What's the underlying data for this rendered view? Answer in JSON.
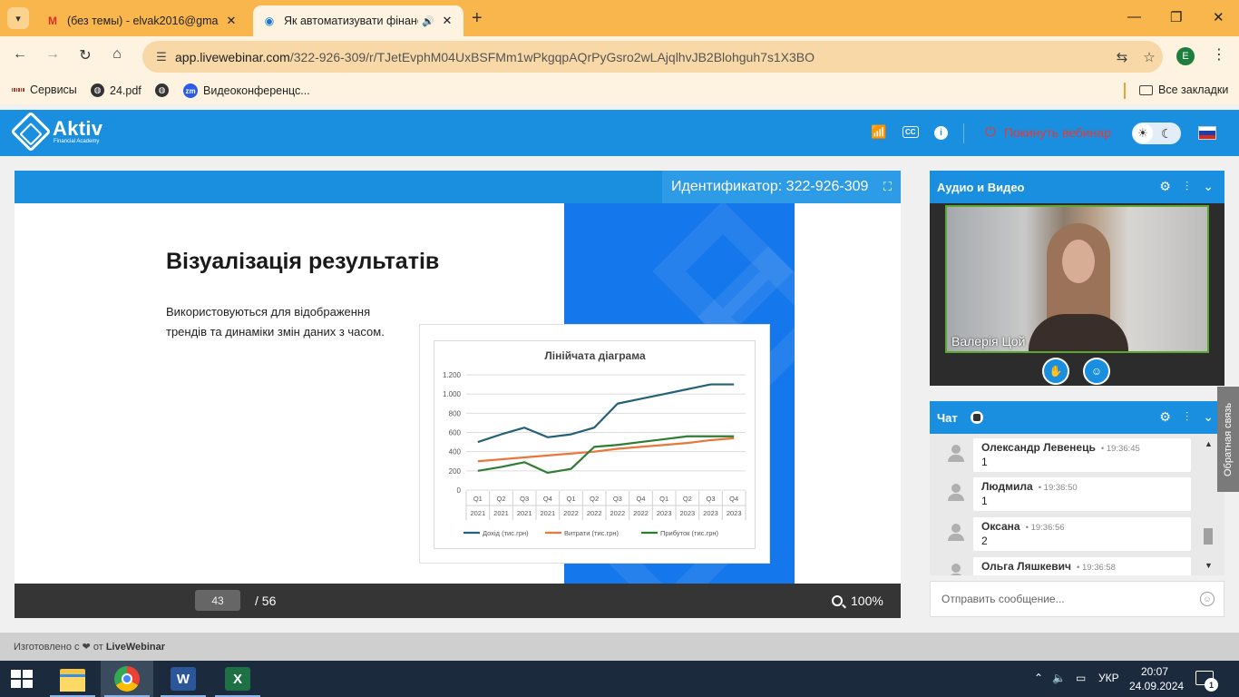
{
  "browser": {
    "tabs": [
      {
        "title": "(без темы) - elvak2016@gmail.",
        "favicon": "gmail-icon",
        "active": false
      },
      {
        "title": "Як автоматизувати фінансо",
        "favicon": "livewebinar-icon",
        "active": true
      }
    ],
    "url_host": "app.livewebinar.com",
    "url_path": "/322-926-309/r/TJetEvphM04UxBSFMm1wPkgqpAQrPyGsro2wLAjqlhvJB2Blohguh7s1X3BO",
    "profile_initial": "E",
    "bookmarks": [
      {
        "label": "Сервисы",
        "icon": "apps-grid-icon"
      },
      {
        "label": "24.pdf",
        "icon": "globe-icon"
      },
      {
        "label": "",
        "icon": "globe-icon"
      },
      {
        "label": "Видеоконференцс...",
        "icon": "zoom-icon"
      }
    ],
    "all_bookmarks": "Все закладки"
  },
  "app": {
    "logo_name": "Aktiv",
    "logo_sub": "Financial Academy",
    "leave_label": "Покинуть вебинар",
    "accent": "#1a8fe0",
    "leave_color": "#e53935"
  },
  "presentation": {
    "identifier": "Идентификатор: 322-926-309",
    "slide_title": "Візуалізація результатів",
    "slide_text": "Використовуються для відображення трендів та динаміки змін даних з часом.",
    "page_current": "43",
    "page_total": "/ 56",
    "zoom": "100%"
  },
  "chart_data": {
    "type": "line",
    "title": "Лінійчата діаграма",
    "categories": [
      "Q1",
      "Q2",
      "Q3",
      "Q4",
      "Q1",
      "Q2",
      "Q3",
      "Q4",
      "Q1",
      "Q2",
      "Q3",
      "Q4"
    ],
    "years": [
      "2021",
      "2021",
      "2021",
      "2021",
      "2022",
      "2022",
      "2022",
      "2022",
      "2023",
      "2023",
      "2023",
      "2023"
    ],
    "ylim": [
      0,
      1200
    ],
    "yticks": [
      "0",
      "200",
      "400",
      "600",
      "800",
      "1.000",
      "1.200"
    ],
    "grid": true,
    "legend_position": "bottom",
    "series": [
      {
        "name": "Дохід (тис.грн)",
        "color": "#24607a",
        "values": [
          500,
          580,
          650,
          550,
          580,
          650,
          900,
          950,
          1000,
          1050,
          1100,
          1100
        ]
      },
      {
        "name": "Витрати (тис.грн)",
        "color": "#e8773a",
        "values": [
          300,
          320,
          340,
          360,
          380,
          400,
          430,
          450,
          470,
          490,
          520,
          540
        ]
      },
      {
        "name": "Прибуток (тис.грн)",
        "color": "#2e7d32",
        "values": [
          200,
          240,
          290,
          180,
          220,
          450,
          470,
          500,
          530,
          560,
          560,
          560
        ]
      }
    ]
  },
  "footer": {
    "made_prefix": "Изготовлено с ❤ от",
    "made_brand": "LiveWebinar"
  },
  "av_panel": {
    "title": "Аудио и Видео",
    "speaker_name": "Валерія Цой"
  },
  "chat": {
    "title": "Чат",
    "messages": [
      {
        "name": "Олександр Левенець",
        "time": "19:36:45",
        "text": "1"
      },
      {
        "name": "Людмила",
        "time": "19:36:50",
        "text": "1"
      },
      {
        "name": "Оксана",
        "time": "19:36:56",
        "text": "2"
      },
      {
        "name": "Ольга Ляшкевич",
        "time": "19:36:58",
        "text": ""
      }
    ],
    "placeholder": "Отправить сообщение..."
  },
  "feedback_label": "Обратная связь",
  "taskbar": {
    "language": "УКР",
    "time": "20:07",
    "date": "24.09.2024",
    "notifications": "1"
  }
}
